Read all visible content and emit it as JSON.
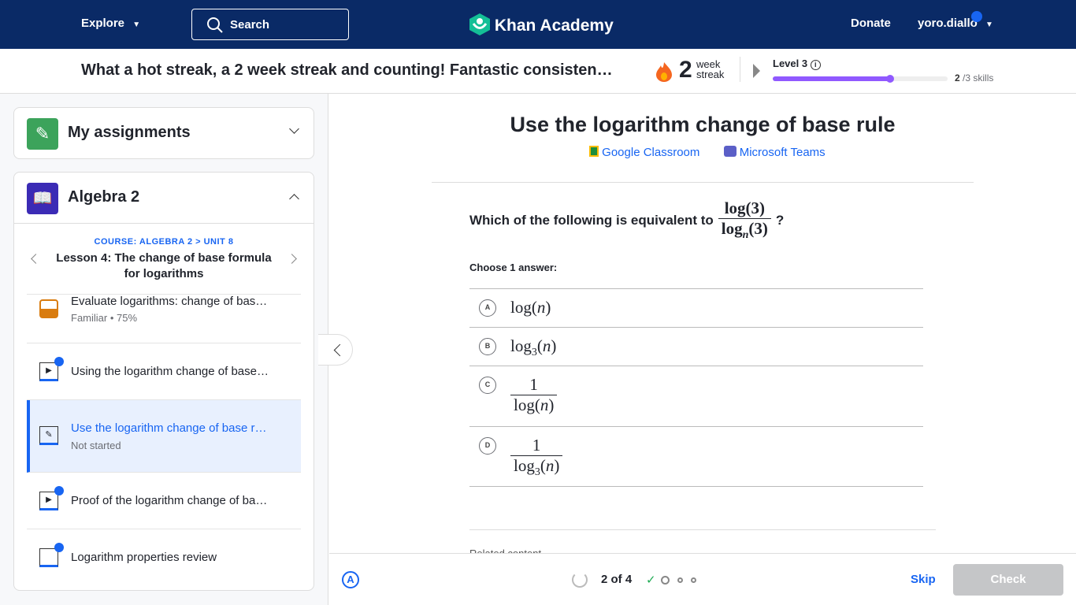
{
  "nav": {
    "explore": "Explore",
    "search_placeholder": "Search",
    "logo": "Khan Academy",
    "donate": "Donate",
    "username": "yoro.diallo"
  },
  "streak": {
    "message": "What a hot streak, a 2 week streak and counting! Fantastic consisten…",
    "count": "2",
    "unit_line1": "week",
    "unit_line2": "streak",
    "level": "Level 3",
    "skills_done": "2",
    "skills_total": "/3 skills",
    "progress_percent": 67,
    "progress_color": "#9059ff"
  },
  "sidebar": {
    "assignments": "My assignments",
    "course": "Algebra 2",
    "breadcrumb": "COURSE: ALGEBRA 2 > UNIT 8",
    "lesson": "Lesson 4: The change of base formula for logarithms",
    "items": [
      {
        "label": "Evaluate logarithms: change of bas…",
        "sub": "Familiar • 75%",
        "icon": "mastery-familiar-icon"
      },
      {
        "label": "Using the logarithm change of base…",
        "icon": "video-icon"
      },
      {
        "label": "Use the logarithm change of base r…",
        "sub": "Not started",
        "icon": "exercise-icon",
        "active": true
      },
      {
        "label": "Proof of the logarithm change of ba…",
        "icon": "video-icon"
      },
      {
        "label": "Logarithm properties review",
        "icon": "article-icon"
      }
    ]
  },
  "main": {
    "title": "Use the logarithm change of base rule",
    "share_google": "Google Classroom",
    "share_teams": "Microsoft Teams",
    "question_text": "Which of the following is equivalent to",
    "question_num": "log(3)",
    "question_den_base": "log",
    "question_den_sub": "n",
    "question_den_arg": "(3)",
    "question_mark": "?",
    "choose": "Choose 1 answer:",
    "choices": [
      {
        "letter": "A"
      },
      {
        "letter": "B"
      },
      {
        "letter": "C"
      },
      {
        "letter": "D"
      }
    ],
    "related": "Related content"
  },
  "footer": {
    "progress": "2 of 4",
    "skip": "Skip",
    "check": "Check"
  }
}
